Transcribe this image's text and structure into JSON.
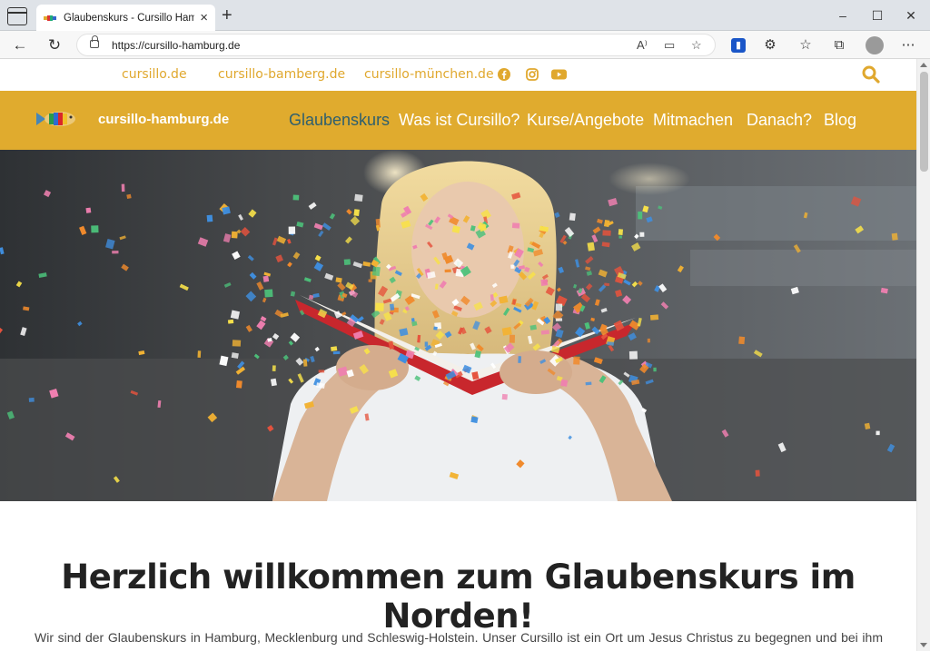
{
  "browser": {
    "tab_title": "Glaubenskurs - Cursillo Hamburg",
    "url": "https://cursillo-hamburg.de"
  },
  "top_links": [
    "cursillo.de",
    "cursillo-bamberg.de",
    "cursillo-münchen.de"
  ],
  "social_icons": [
    "facebook-icon",
    "instagram-icon",
    "youtube-icon"
  ],
  "nav": {
    "site_name": "cursillo-hamburg.de",
    "items": [
      "Glaubenskurs",
      "Was ist Cursillo?",
      "Kurse/Angebote",
      "Mitmachen",
      "Danach?",
      "Blog"
    ],
    "active": "Glaubenskurs"
  },
  "colors": {
    "brand": "#e0ab2e",
    "active_nav": "#2e5f6e",
    "toplink": "#e0a82e"
  },
  "main": {
    "heading": "Herzlich willkommen zum Glaubenskurs im Norden!",
    "intro": "Wir sind der Glaubenskurs in Hamburg, Mecklenburg und Schleswig-Holstein. Unser Cursillo ist ein Ort um Jesus Christus zu begegnen und bei ihm"
  }
}
